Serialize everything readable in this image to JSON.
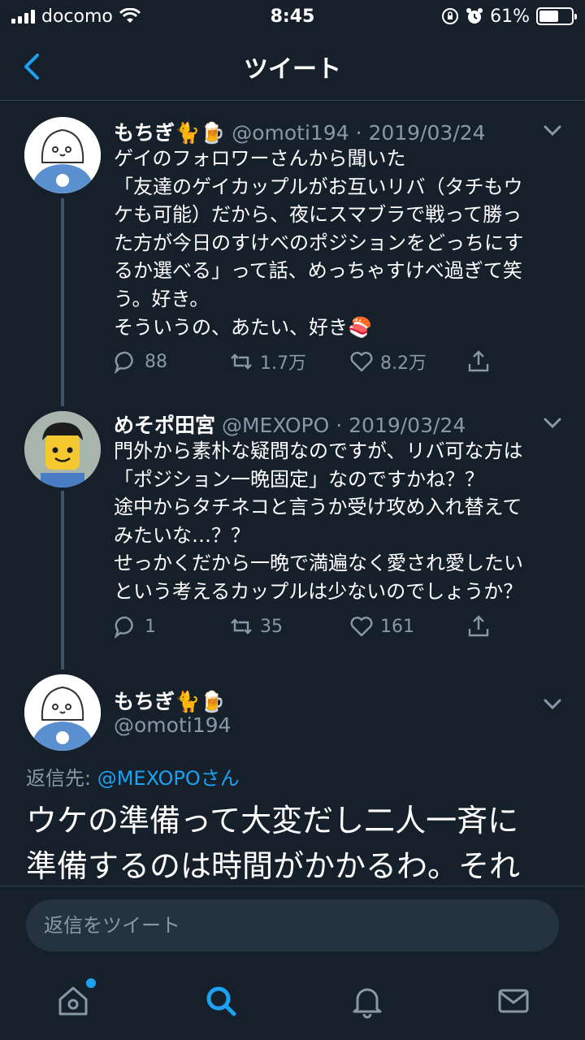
{
  "status_bar": {
    "carrier": "docomo",
    "time": "8:45",
    "battery": "61%",
    "battery_level": 0.61
  },
  "header": {
    "title": "ツイート"
  },
  "tweets": [
    {
      "name": "もちぎ🐈🍺",
      "handle": "@omoti194 · 2019/03/24",
      "lines": [
        "ゲイのフォロワーさんから聞いた",
        "「友達のゲイカップルがお互いリバ（タチもウ",
        "ケも可能）だから、夜にスマブラで戦って勝っ",
        "た方が今日のすけべのポジションをどっちにす",
        "るか選べる」って話、めっちゃすけべ過ぎて笑",
        "う。好き。",
        "そういうの、あたい、好き🍣"
      ],
      "replies": "88",
      "retweets": "1.7万",
      "likes": "8.2万"
    },
    {
      "name": "めそポ田宮",
      "handle": "@MEXOPO · 2019/03/24",
      "lines": [
        "門外から素朴な疑問なのですが、リバ可な方は",
        "「ポジション一晩固定」なのですかね？？",
        "途中からタチネコと言うか受け攻め入れ替えて",
        "みたいな…？？",
        "せっかくだから一晩で満遍なく愛され愛したい",
        "という考えるカップルは少ないのでしょうか？"
      ],
      "replies": "1",
      "retweets": "35",
      "likes": "161"
    }
  ],
  "main_tweet": {
    "name": "もちぎ🐈🍺",
    "handle": "@omoti194",
    "reply_to_label": "返信先: ",
    "reply_to_mention": "@MEXOPOさん",
    "lines": [
      "ウケの準備って大変だし二人一斉に",
      "準備するのは時間がかかるわ。それ"
    ]
  },
  "reply_bar": {
    "placeholder": "返信をツイート"
  },
  "tabs": [
    "home-icon",
    "search-icon",
    "notifications-icon",
    "messages-icon"
  ],
  "colors": {
    "background": "#15202b",
    "accent": "#1da1f2",
    "secondary_text": "#8899a6"
  }
}
